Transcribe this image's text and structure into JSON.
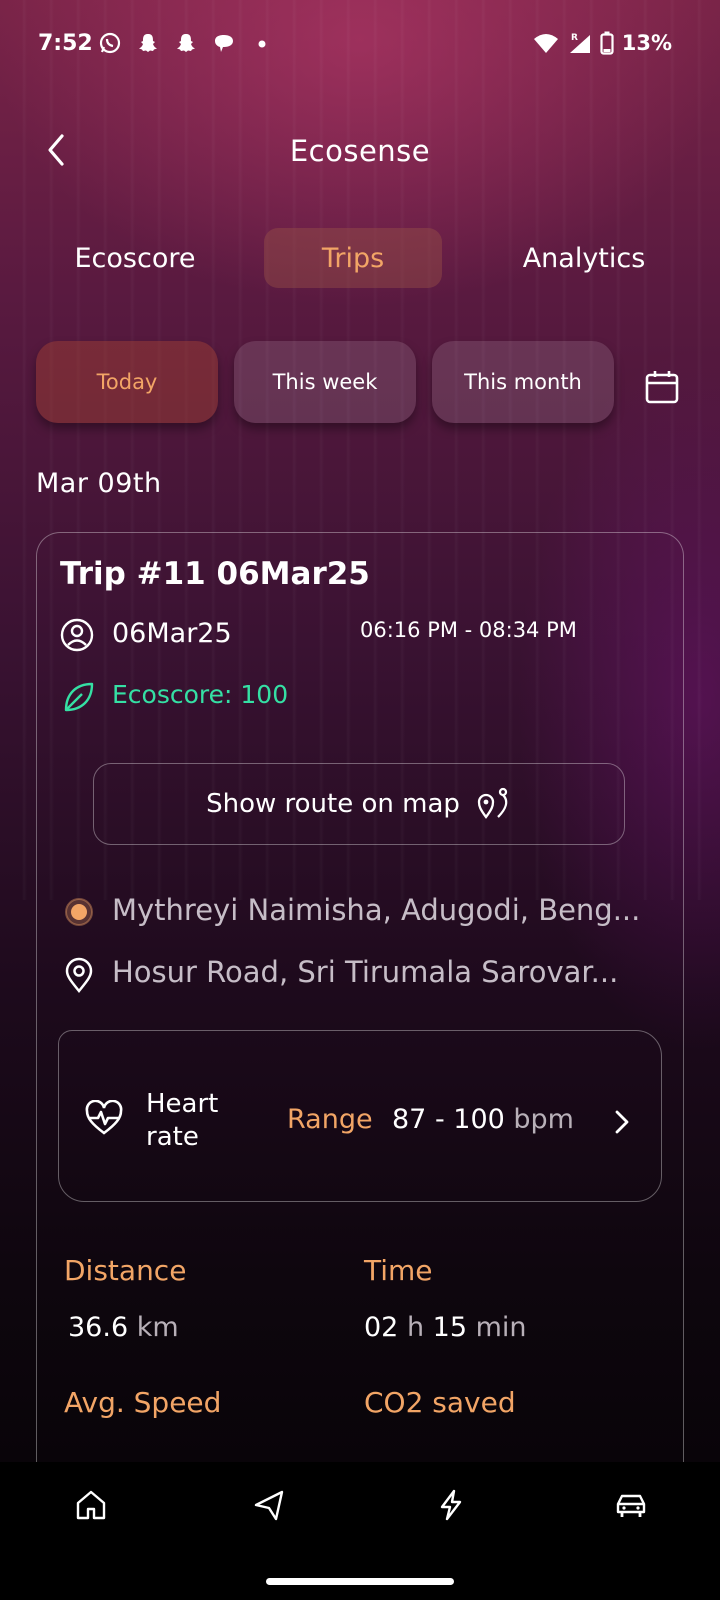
{
  "status_bar": {
    "time": "7:52",
    "battery": "13%",
    "icons": [
      "whatsapp-icon",
      "snapchat-icon",
      "snapchat-icon",
      "chat-bubble-icon",
      "dot-icon"
    ],
    "network_tag": "R"
  },
  "header": {
    "title": "Ecosense"
  },
  "tabs": [
    {
      "label": "Ecoscore"
    },
    {
      "label": "Trips"
    },
    {
      "label": "Analytics"
    }
  ],
  "active_tab": "Trips",
  "filters": [
    {
      "label": "Today"
    },
    {
      "label": "This week"
    },
    {
      "label": "This month"
    }
  ],
  "active_filter": "Today",
  "date_header": "Mar 09th",
  "trip": {
    "title": "Trip #11 06Mar25",
    "user_date": "06Mar25",
    "time_range": "06:16 PM - 08:34 PM",
    "ecoscore": "Ecoscore: 100",
    "route_button": "Show route on map",
    "start_location": "Mythreyi Naimisha, Adugodi, Beng...",
    "end_location": "Hosur Road, Sri Tirumala Sarovar...",
    "heart_rate": {
      "label_line1": "Heart",
      "label_line2": "rate",
      "range_label": "Range",
      "range_value": "87 - 100",
      "unit": "bpm"
    },
    "stats": {
      "distance_label": "Distance",
      "distance_value": "36.6",
      "distance_unit": "km",
      "time_label": "Time",
      "time_hours": "02",
      "time_h": "h",
      "time_minutes": "15",
      "time_min": "min",
      "avg_speed_label": "Avg. Speed",
      "co2_label": "CO2 saved"
    }
  },
  "colors": {
    "accent": "#f2a566",
    "eco_green": "#35e0a4"
  },
  "bottom_nav": [
    "home-icon",
    "navigation-icon",
    "charging-icon",
    "car-icon"
  ]
}
